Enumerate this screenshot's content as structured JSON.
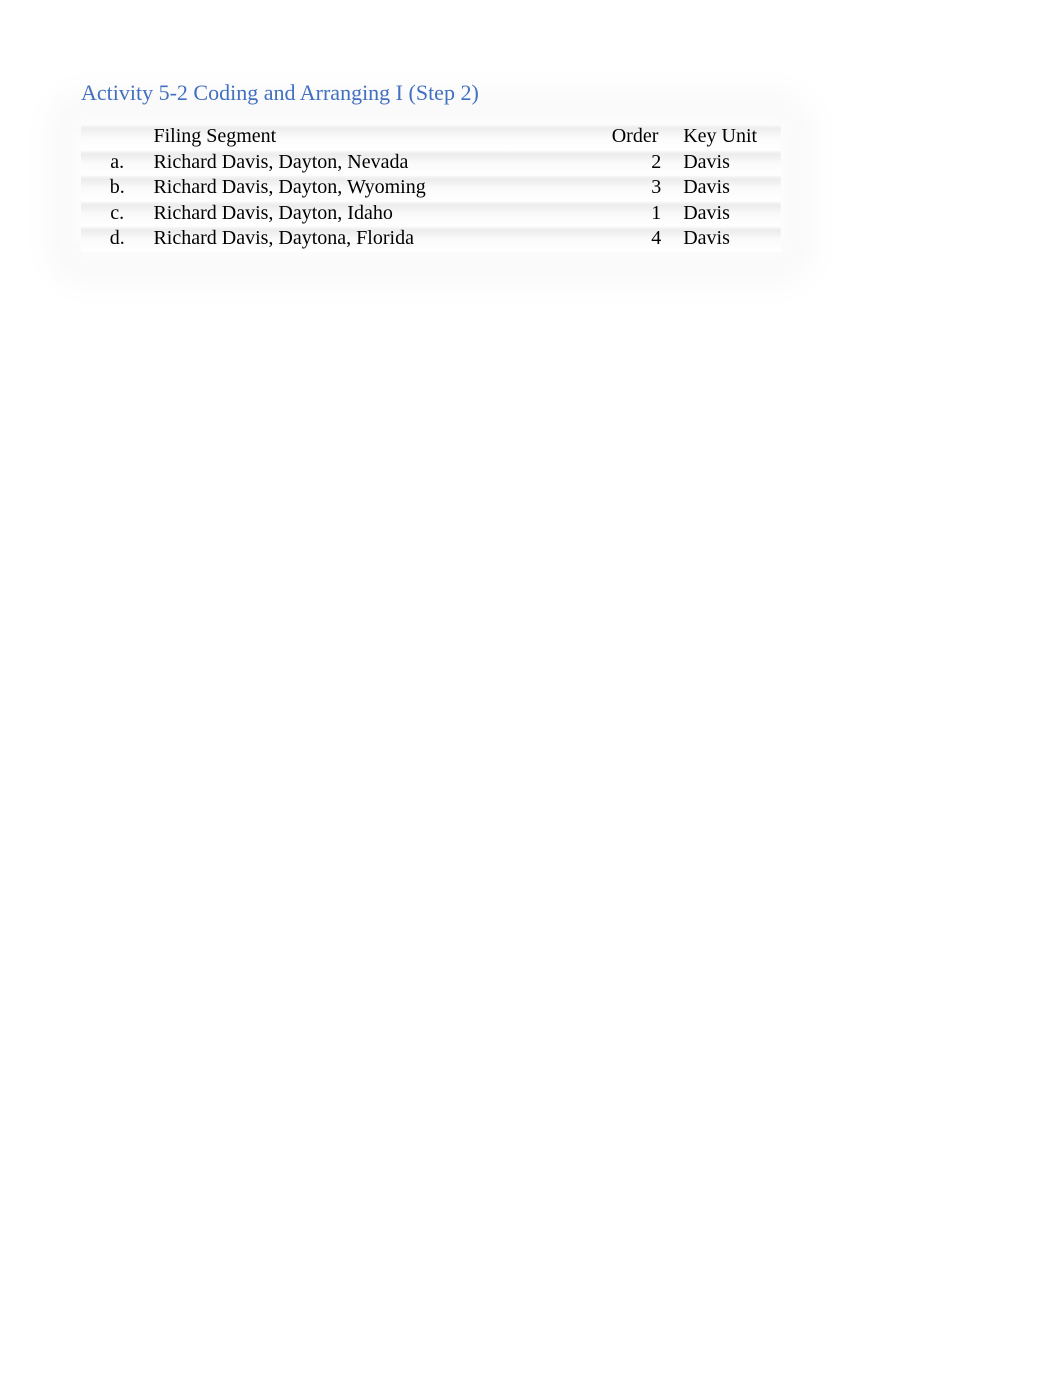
{
  "title": "Activity 5-2 Coding and Arranging I (Step 2)",
  "headers": {
    "letter": "",
    "filing_segment": "Filing Segment",
    "order": "Order",
    "key_unit": "Key Unit"
  },
  "rows": [
    {
      "letter": "a.",
      "filing_segment": "Richard Davis, Dayton, Nevada",
      "order": "2",
      "key_unit": "Davis"
    },
    {
      "letter": "b.",
      "filing_segment": "Richard Davis, Dayton, Wyoming",
      "order": "3",
      "key_unit": "Davis"
    },
    {
      "letter": "c.",
      "filing_segment": "Richard Davis, Dayton, Idaho",
      "order": "1",
      "key_unit": "Davis"
    },
    {
      "letter": "d.",
      "filing_segment": "Richard Davis, Daytona, Florida",
      "order": "4",
      "key_unit": "Davis"
    }
  ]
}
